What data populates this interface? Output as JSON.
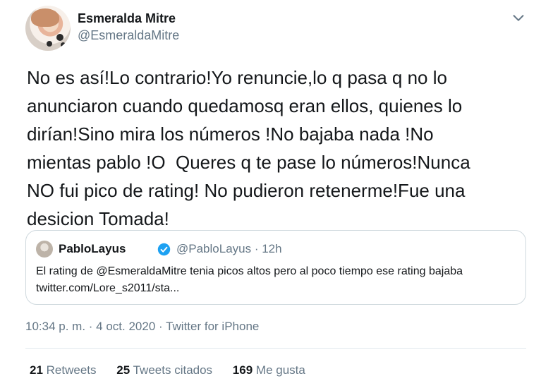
{
  "author": {
    "display_name": "Esmeralda Mitre",
    "handle": "@EsmeraldaMitre"
  },
  "tweet": {
    "text": "No es así!Lo contrario!Yo renuncie,lo q pasa q no lo\nanunciaron cuando quedamosq eran ellos, quienes lo\ndirían!Sino mira los números !No bajaba nada !No\nmientas pablo !O  Queres q te pase lo números!Nunca\nNO fui pico de rating! No pudieron retenerme!Fue una\ndesicion Tomada!"
  },
  "quoted": {
    "display_name": "PabloLayus",
    "meta": "@PabloLayus · 12h",
    "text": "El rating de @EsmeraldaMitre tenia picos altos pero al poco tiempo ese rating bajaba twitter.com/Lore_s2011/sta..."
  },
  "meta": {
    "line": "10:34 p. m. · 4 oct. 2020 · Twitter for iPhone"
  },
  "stats": {
    "retweets_count": "21",
    "retweets_label": "Retweets",
    "quotes_count": "25",
    "quotes_label": "Tweets citados",
    "likes_count": "169",
    "likes_label": "Me gusta"
  },
  "icons": {
    "chevron": "chevron-down-icon",
    "verified": "verified-badge-icon"
  },
  "colors": {
    "text_primary": "#14171a",
    "text_secondary": "#657786",
    "verified_blue": "#1da1f2",
    "border": "#cfd9de"
  }
}
